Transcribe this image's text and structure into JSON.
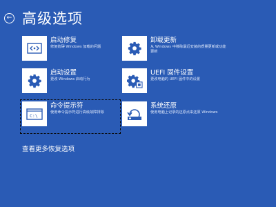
{
  "page": {
    "back_glyph": "←",
    "title": "高级选项",
    "more_link": "查看更多恢复选项"
  },
  "tiles": [
    {
      "icon": "startup-repair-icon",
      "title": "启动修复",
      "desc": "修复妨碍 Windows 加载的问题"
    },
    {
      "icon": "gear-icon",
      "title": "卸载更新",
      "desc": "从 Windows 中移除最近安装的质量更新或功能更新"
    },
    {
      "icon": "gear-icon",
      "title": "启动设置",
      "desc": "更改 Windows 启动行为"
    },
    {
      "icon": "firmware-gear-icon",
      "title": "UEFI 固件设置",
      "desc": "更改电脑的 UEFI 固件中的设置"
    },
    {
      "icon": "command-prompt-icon",
      "title": "命令提示符",
      "desc": "使用命令提示符进行高级故障排除",
      "focused": true
    },
    {
      "icon": "system-restore-icon",
      "title": "系统还原",
      "desc": "使用电脑上记录的还原点来还原 Windows"
    }
  ],
  "colors": {
    "background": "#2a5bb5",
    "tile_icon_bg": "#ffffff",
    "text": "#ffffff",
    "focus_outline": "#0a0a0a"
  }
}
